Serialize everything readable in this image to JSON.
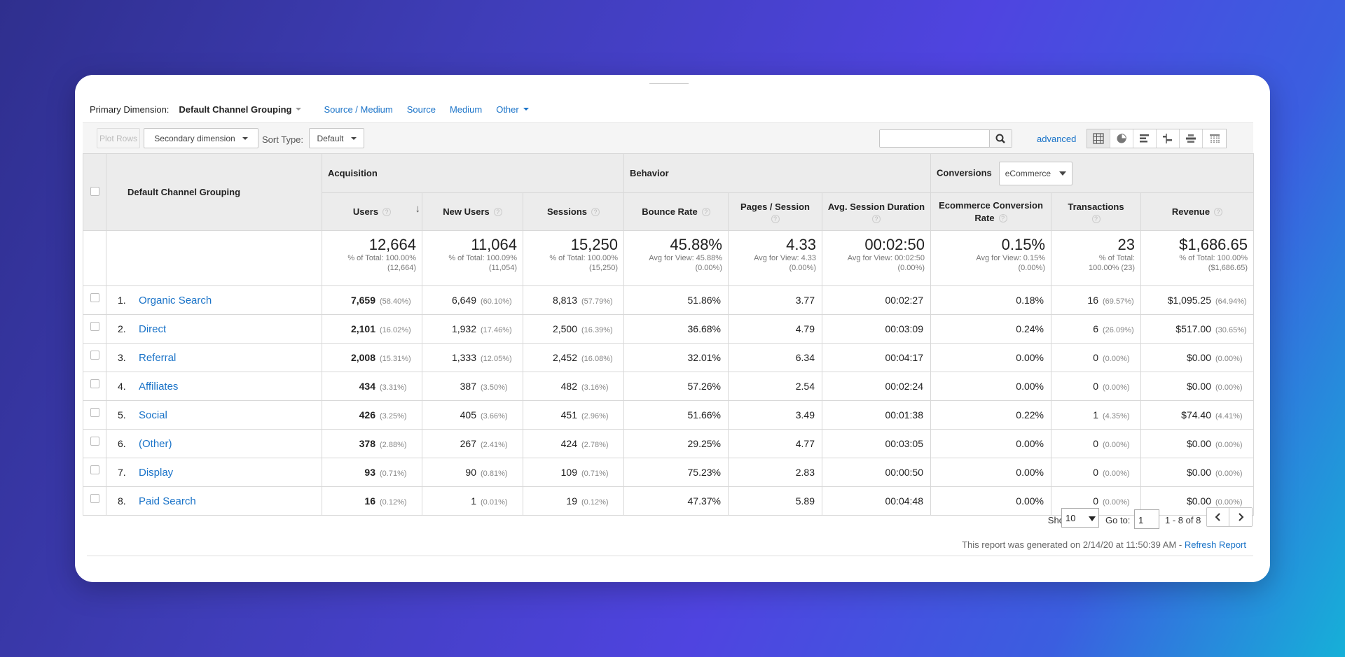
{
  "dimension_bar": {
    "label": "Primary Dimension:",
    "selected": "Default Channel Grouping",
    "links": [
      "Source / Medium",
      "Source",
      "Medium",
      "Other"
    ]
  },
  "toolbar": {
    "plot_rows": "Plot Rows",
    "secondary_dimension": "Secondary dimension",
    "sort_type_label": "Sort Type:",
    "sort_type_value": "Default",
    "search_placeholder": "",
    "advanced": "advanced",
    "view_icons": [
      "table-view-icon",
      "pie-view-icon",
      "performance-view-icon",
      "comparison-view-icon",
      "term-cloud-view-icon",
      "pivot-view-icon"
    ]
  },
  "table": {
    "groups": {
      "dimension": "Default Channel Grouping",
      "acquisition": "Acquisition",
      "behavior": "Behavior",
      "conversions": "Conversions",
      "conversions_select": "eCommerce"
    },
    "columns": {
      "users": "Users",
      "new_users": "New Users",
      "sessions": "Sessions",
      "bounce_rate": "Bounce Rate",
      "pages_session": "Pages / Session",
      "avg_duration": "Avg. Session Duration",
      "ecom_rate": "Ecommerce Conversion Rate",
      "transactions": "Transactions",
      "revenue": "Revenue"
    },
    "totals": {
      "users": {
        "value": "12,664",
        "sub1": "% of Total: 100.00%",
        "sub2": "(12,664)"
      },
      "new_users": {
        "value": "11,064",
        "sub1": "% of Total: 100.09%",
        "sub2": "(11,054)"
      },
      "sessions": {
        "value": "15,250",
        "sub1": "% of Total: 100.00%",
        "sub2": "(15,250)"
      },
      "bounce_rate": {
        "value": "45.88%",
        "sub1": "Avg for View: 45.88%",
        "sub2": "(0.00%)"
      },
      "pages_session": {
        "value": "4.33",
        "sub1": "Avg for View: 4.33",
        "sub2": "(0.00%)"
      },
      "avg_duration": {
        "value": "00:02:50",
        "sub1": "Avg for View: 00:02:50",
        "sub2": "(0.00%)"
      },
      "ecom_rate": {
        "value": "0.15%",
        "sub1": "Avg for View: 0.15%",
        "sub2": "(0.00%)"
      },
      "transactions": {
        "value": "23",
        "sub1": "% of Total:",
        "sub2": "100.00% (23)"
      },
      "revenue": {
        "value": "$1,686.65",
        "sub1": "% of Total: 100.00%",
        "sub2": "($1,686.65)"
      }
    },
    "rows": [
      {
        "num": "1.",
        "name": "Organic Search",
        "users": "7,659",
        "users_pct": "(58.40%)",
        "new_users": "6,649",
        "new_users_pct": "(60.10%)",
        "sessions": "8,813",
        "sessions_pct": "(57.79%)",
        "bounce": "51.86%",
        "pages": "3.77",
        "duration": "00:02:27",
        "ecom": "0.18%",
        "trans": "16",
        "trans_pct": "(69.57%)",
        "revenue": "$1,095.25",
        "revenue_pct": "(64.94%)"
      },
      {
        "num": "2.",
        "name": "Direct",
        "users": "2,101",
        "users_pct": "(16.02%)",
        "new_users": "1,932",
        "new_users_pct": "(17.46%)",
        "sessions": "2,500",
        "sessions_pct": "(16.39%)",
        "bounce": "36.68%",
        "pages": "4.79",
        "duration": "00:03:09",
        "ecom": "0.24%",
        "trans": "6",
        "trans_pct": "(26.09%)",
        "revenue": "$517.00",
        "revenue_pct": "(30.65%)"
      },
      {
        "num": "3.",
        "name": "Referral",
        "users": "2,008",
        "users_pct": "(15.31%)",
        "new_users": "1,333",
        "new_users_pct": "(12.05%)",
        "sessions": "2,452",
        "sessions_pct": "(16.08%)",
        "bounce": "32.01%",
        "pages": "6.34",
        "duration": "00:04:17",
        "ecom": "0.00%",
        "trans": "0",
        "trans_pct": "(0.00%)",
        "revenue": "$0.00",
        "revenue_pct": "(0.00%)"
      },
      {
        "num": "4.",
        "name": "Affiliates",
        "users": "434",
        "users_pct": "(3.31%)",
        "new_users": "387",
        "new_users_pct": "(3.50%)",
        "sessions": "482",
        "sessions_pct": "(3.16%)",
        "bounce": "57.26%",
        "pages": "2.54",
        "duration": "00:02:24",
        "ecom": "0.00%",
        "trans": "0",
        "trans_pct": "(0.00%)",
        "revenue": "$0.00",
        "revenue_pct": "(0.00%)"
      },
      {
        "num": "5.",
        "name": "Social",
        "users": "426",
        "users_pct": "(3.25%)",
        "new_users": "405",
        "new_users_pct": "(3.66%)",
        "sessions": "451",
        "sessions_pct": "(2.96%)",
        "bounce": "51.66%",
        "pages": "3.49",
        "duration": "00:01:38",
        "ecom": "0.22%",
        "trans": "1",
        "trans_pct": "(4.35%)",
        "revenue": "$74.40",
        "revenue_pct": "(4.41%)"
      },
      {
        "num": "6.",
        "name": "(Other)",
        "users": "378",
        "users_pct": "(2.88%)",
        "new_users": "267",
        "new_users_pct": "(2.41%)",
        "sessions": "424",
        "sessions_pct": "(2.78%)",
        "bounce": "29.25%",
        "pages": "4.77",
        "duration": "00:03:05",
        "ecom": "0.00%",
        "trans": "0",
        "trans_pct": "(0.00%)",
        "revenue": "$0.00",
        "revenue_pct": "(0.00%)"
      },
      {
        "num": "7.",
        "name": "Display",
        "users": "93",
        "users_pct": "(0.71%)",
        "new_users": "90",
        "new_users_pct": "(0.81%)",
        "sessions": "109",
        "sessions_pct": "(0.71%)",
        "bounce": "75.23%",
        "pages": "2.83",
        "duration": "00:00:50",
        "ecom": "0.00%",
        "trans": "0",
        "trans_pct": "(0.00%)",
        "revenue": "$0.00",
        "revenue_pct": "(0.00%)"
      },
      {
        "num": "8.",
        "name": "Paid Search",
        "users": "16",
        "users_pct": "(0.12%)",
        "new_users": "1",
        "new_users_pct": "(0.01%)",
        "sessions": "19",
        "sessions_pct": "(0.12%)",
        "bounce": "47.37%",
        "pages": "5.89",
        "duration": "00:04:48",
        "ecom": "0.00%",
        "trans": "0",
        "trans_pct": "(0.00%)",
        "revenue": "$0.00",
        "revenue_pct": "(0.00%)"
      }
    ]
  },
  "footer": {
    "show_rows_label": "Show rows:",
    "show_rows_value": "10",
    "goto_label": "Go to:",
    "goto_value": "1",
    "range": "1 - 8 of 8",
    "generated": "This report was generated on 2/14/20 at 11:50:39 AM - ",
    "refresh": "Refresh Report"
  },
  "colors": {
    "link": "#1a73c8",
    "header_bg": "#ececec",
    "background_gradient": [
      "#2f2f8e",
      "#4f44e0",
      "#16b0d8"
    ]
  }
}
